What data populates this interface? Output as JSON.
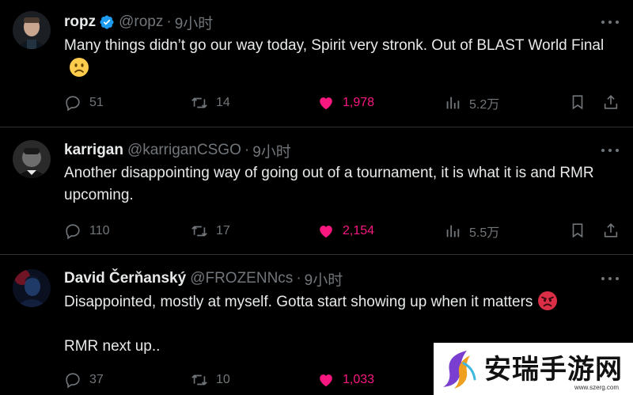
{
  "tweets": [
    {
      "name": "ropz",
      "verified": true,
      "handle": "@ropz",
      "separator": "·",
      "time": "9小时",
      "text": "Many things didn’t go our way today, Spirit very stronk. Out of BLAST World Final",
      "emoji": "slightly-frowning-face",
      "replies": "51",
      "retweets": "14",
      "likes": "1,978",
      "views": "5.2万",
      "liked": true
    },
    {
      "name": "karrigan",
      "verified": false,
      "handle": "@karriganCSGO",
      "separator": "·",
      "time": "9小时",
      "text": "Another disappointing way of going out of a tournament, it is what it is and RMR upcoming.",
      "replies": "110",
      "retweets": "17",
      "likes": "2,154",
      "views": "5.5万",
      "liked": true
    },
    {
      "name": "David Čerňanský",
      "verified": false,
      "handle": "@FROZENNcs",
      "separator": "·",
      "time": "9小时",
      "text": "Disappointed, mostly at myself. Gotta start showing up when it matters",
      "text_line2": "RMR next up..",
      "emoji": "angry-face",
      "replies": "37",
      "retweets": "10",
      "likes": "1,033",
      "liked": true
    }
  ],
  "watermark": {
    "title": "安瑞手游网",
    "url": "www.szerg.com"
  },
  "colors": {
    "background": "#000000",
    "text": "#e7e9ea",
    "muted": "#71767b",
    "like": "#f91880",
    "verified": "#1d9bf0",
    "divider": "#2f3336"
  },
  "icons": [
    "reply-icon",
    "retweet-icon",
    "heart-icon",
    "views-icon",
    "bookmark-icon",
    "share-icon",
    "more-icon",
    "verified-badge-icon"
  ]
}
